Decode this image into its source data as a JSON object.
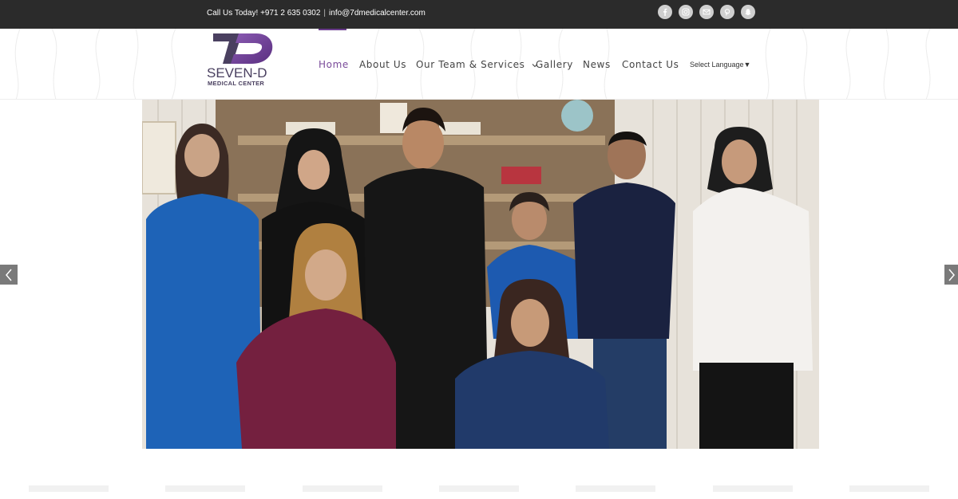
{
  "topbar": {
    "call_text": "Call Us Today! +971 2 635 0302",
    "separator": "|",
    "email": "info@7dmedicalcenter.com",
    "socials": [
      "facebook-icon",
      "instagram-icon",
      "email-icon",
      "pinterest-icon",
      "snapchat-icon"
    ]
  },
  "header": {
    "logo": {
      "mark": "7D",
      "name": "SEVEN-D",
      "subtitle": "MEDICAL CENTER",
      "colors": {
        "primary": "#6a3d8c",
        "secondary": "#4a4060"
      }
    },
    "nav": [
      {
        "label": "Home",
        "active": true
      },
      {
        "label": "About Us"
      },
      {
        "label": "Our Team & Services",
        "dropdown": true
      },
      {
        "label": "Gallery"
      },
      {
        "label": "News"
      },
      {
        "label": "Contact Us"
      }
    ],
    "language": "Select Language​▼"
  },
  "hero": {
    "image": "team-photo",
    "prev": "prev-arrow-icon",
    "next": "next-arrow-icon"
  },
  "colors": {
    "topbar_bg": "#2b2b2b",
    "accent": "#7a4b9a",
    "nav_text": "#444444"
  }
}
